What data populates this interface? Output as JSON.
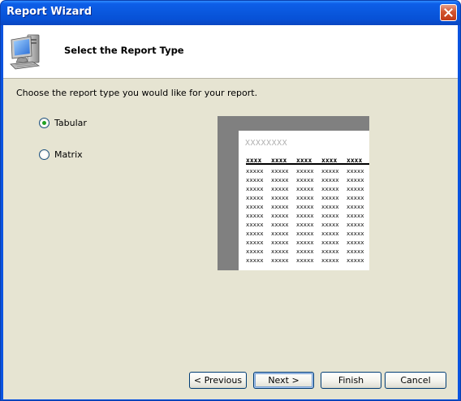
{
  "window": {
    "title": "Report Wizard"
  },
  "header": {
    "title": "Select the Report Type"
  },
  "instruction": "Choose the report type you would like for your report.",
  "options": [
    {
      "label": "Tabular",
      "selected": true
    },
    {
      "label": "Matrix",
      "selected": false
    }
  ],
  "preview": {
    "title": "XXXXXXXX",
    "header_cells": [
      "xxxx",
      "xxxx",
      "xxxx",
      "xxxx",
      "xxxx"
    ],
    "rows": [
      [
        "xxxxx",
        "xxxxx",
        "xxxxx",
        "xxxxx",
        "xxxxx"
      ],
      [
        "xxxxx",
        "xxxxx",
        "xxxxx",
        "xxxxx",
        "xxxxx"
      ],
      [
        "xxxxx",
        "xxxxx",
        "xxxxx",
        "xxxxx",
        "xxxxx"
      ],
      [
        "xxxxx",
        "xxxxx",
        "xxxxx",
        "xxxxx",
        "xxxxx"
      ],
      [
        "xxxxx",
        "xxxxx",
        "xxxxx",
        "xxxxx",
        "xxxxx"
      ],
      [
        "xxxxx",
        "xxxxx",
        "xxxxx",
        "xxxxx",
        "xxxxx"
      ],
      [
        "xxxxx",
        "xxxxx",
        "xxxxx",
        "xxxxx",
        "xxxxx"
      ],
      [
        "xxxxx",
        "xxxxx",
        "xxxxx",
        "xxxxx",
        "xxxxx"
      ],
      [
        "xxxxx",
        "xxxxx",
        "xxxxx",
        "xxxxx",
        "xxxxx"
      ],
      [
        "xxxxx",
        "xxxxx",
        "xxxxx",
        "xxxxx",
        "xxxxx"
      ],
      [
        "xxxxx",
        "xxxxx",
        "xxxxx",
        "xxxxx",
        "xxxxx"
      ]
    ]
  },
  "buttons": {
    "previous": "< Previous",
    "next": "Next >",
    "finish": "Finish",
    "cancel": "Cancel"
  },
  "icons": {
    "header": "computer-icon",
    "close": "close-icon"
  },
  "colors": {
    "titlebar": "#0a58de",
    "client_background": "#ecead9",
    "close_button": "#d2542f",
    "radio_dot": "#21a121",
    "button_border": "#003c74"
  }
}
